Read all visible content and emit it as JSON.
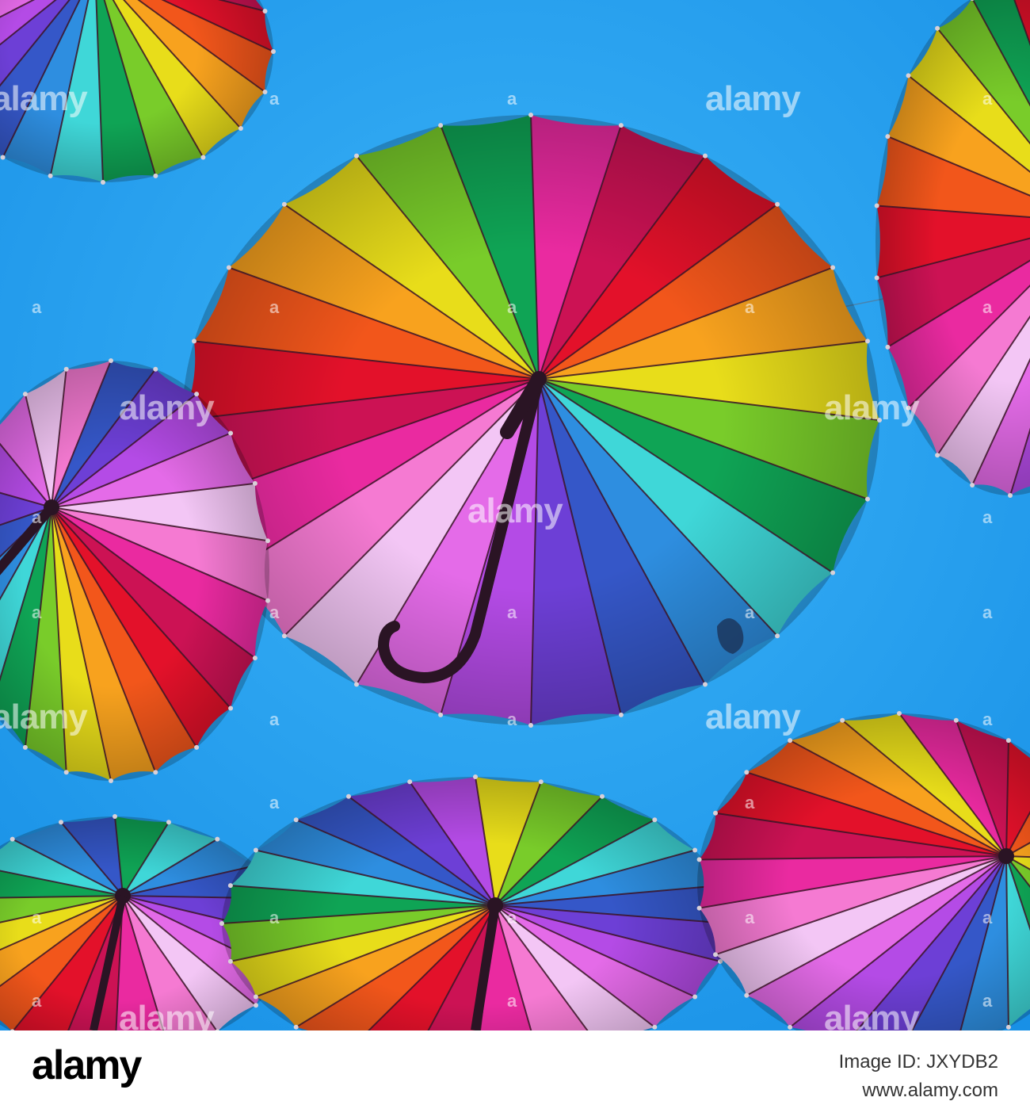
{
  "photo": {
    "subject": "umbrellas",
    "colors": {
      "sky": "#1e9ff0",
      "sky_light": "#3cb4f8",
      "handle": "#2a1424",
      "rib": "#3b1426",
      "rainbow": [
        "#e3112a",
        "#f2561b",
        "#f8a21e",
        "#e8dd1a",
        "#79cc2a",
        "#0fa455",
        "#3fd7d8",
        "#2e8ee0",
        "#3557c8",
        "#6d3fd6",
        "#b44be6",
        "#e46be8",
        "#f3c6f5",
        "#f57ad2",
        "#ea2aa0",
        "#cc1254"
      ]
    }
  },
  "watermark": {
    "text": "alamy",
    "small": "a"
  },
  "footer": {
    "logo": "alamy",
    "image_id_label": "Image ID: JXYDB2",
    "url": "www.alamy.com"
  }
}
